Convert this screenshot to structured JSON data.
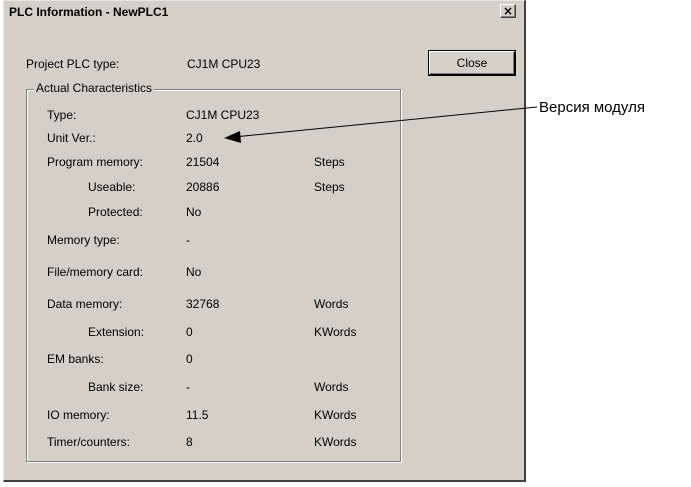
{
  "window": {
    "title": "PLC Information - NewPLC1",
    "close_glyph": "×"
  },
  "project": {
    "label": "Project PLC type:",
    "value": "CJ1M CPU23"
  },
  "close_button": {
    "label": "Close"
  },
  "group": {
    "legend": "Actual Characteristics"
  },
  "rows": [
    {
      "label": "Type:",
      "value": "CJ1M CPU23",
      "unit": ""
    },
    {
      "label": "Unit Ver.:",
      "value": "2.0",
      "unit": ""
    },
    {
      "label": "Program memory:",
      "value": "21504",
      "unit": "Steps"
    },
    {
      "label": "Useable:",
      "value": "20886",
      "unit": "Steps"
    },
    {
      "label": "Protected:",
      "value": "No",
      "unit": ""
    },
    {
      "label": "Memory type:",
      "value": "-",
      "unit": ""
    },
    {
      "label": "File/memory card:",
      "value": "No",
      "unit": ""
    },
    {
      "label": "Data memory:",
      "value": "32768",
      "unit": "Words"
    },
    {
      "label": "Extension:",
      "value": "0",
      "unit": "KWords"
    },
    {
      "label": "EM banks:",
      "value": "0",
      "unit": ""
    },
    {
      "label": "Bank size:",
      "value": "-",
      "unit": "Words"
    },
    {
      "label": "IO memory:",
      "value": "11.5",
      "unit": "KWords"
    },
    {
      "label": "Timer/counters:",
      "value": "8",
      "unit": "KWords"
    }
  ],
  "annotation": {
    "text": "Версия модуля"
  }
}
